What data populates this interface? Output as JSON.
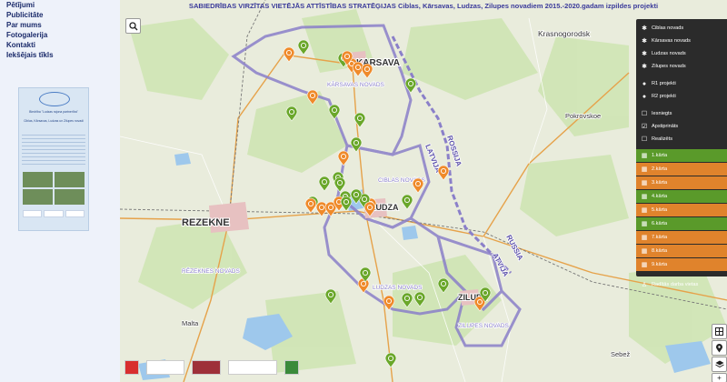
{
  "nav": {
    "items": [
      "Pētījumi",
      "Publicitāte",
      "Par mums",
      "Fotogalerija",
      "Kontakti",
      "Iekšējais tīkls"
    ]
  },
  "poster": {
    "org": "Biedrība \"Ludzas rajona partnerība\"",
    "lines": [
      "Biedrība \"Ludzas rajona partnerība\"",
      "Ciblas, Kārsavas, Ludzas un Zilupes novadi"
    ]
  },
  "map": {
    "title": "SABIEDRĪBAS VIRZĪTAS VIETĒJĀS ATTĪSTĪBAS STRATĒĢIJAS Ciblas, Kārsavas, Ludzas, Zilupes novadiem 2015.-2020.gadam izpildes projekti",
    "labels": {
      "rezekne": "REZEKNE",
      "karsava": "KARSAVA",
      "karsavas_novads": "KĀRSAVAS NOVADS",
      "ciblas_novads": "CIBLAS NOVADS",
      "ludza": "LUDZA",
      "ludzas_novads": "LUDZAS NOVADS",
      "zilupe": "ZILUPE",
      "zilupes_novads": "ZILUPES NOVADS",
      "rezeknes_novads": "RĒZEKNES NOVADS",
      "krasnogorodsk": "Krasnogorodsk",
      "latvija": "LATVIJA",
      "rossija1": "ROSSIJA",
      "rossija2": "RUSSIA",
      "atvija": "ATVIJA",
      "malta": "Malta",
      "sebez": "Sebež",
      "pokrovskoe": "Pokrovskoe"
    },
    "colors": {
      "green_pin": "#6aa72a",
      "orange_pin": "#ef8a2a",
      "border": "#8a7fc9"
    },
    "pins": [
      {
        "type": "green"
      },
      {
        "type": "orange"
      },
      {
        "type": "green"
      },
      {
        "type": "orange"
      },
      {
        "type": "orange"
      },
      {
        "type": "orange"
      },
      {
        "type": "orange"
      },
      {
        "type": "green"
      },
      {
        "type": "orange"
      },
      {
        "type": "green"
      },
      {
        "type": "green"
      },
      {
        "type": "green"
      },
      {
        "type": "green"
      },
      {
        "type": "orange"
      },
      {
        "type": "green"
      },
      {
        "type": "green"
      },
      {
        "type": "green"
      },
      {
        "type": "green"
      },
      {
        "type": "orange"
      },
      {
        "type": "green"
      },
      {
        "type": "orange"
      },
      {
        "type": "orange"
      },
      {
        "type": "orange"
      },
      {
        "type": "green"
      },
      {
        "type": "green"
      },
      {
        "type": "orange"
      },
      {
        "type": "green"
      },
      {
        "type": "orange"
      },
      {
        "type": "orange"
      },
      {
        "type": "orange"
      },
      {
        "type": "green"
      },
      {
        "type": "orange"
      },
      {
        "type": "green"
      },
      {
        "type": "green"
      },
      {
        "type": "green"
      },
      {
        "type": "orange"
      },
      {
        "type": "green"
      },
      {
        "type": "green"
      },
      {
        "type": "green"
      },
      {
        "type": "orange"
      },
      {
        "type": "green"
      }
    ]
  },
  "panel": {
    "novadi": [
      "Ciblas novads",
      "Kārsavas novads",
      "Ludzas novads",
      "Zilupes novads"
    ],
    "projekti": [
      "R1 projekti",
      "R2 projekti"
    ],
    "statusi": [
      "Iesniegts",
      "Apstiprināts",
      "Realizēts"
    ],
    "kartas": [
      {
        "label": "1.kārta",
        "color": "green"
      },
      {
        "label": "2.kārta",
        "color": "orange"
      },
      {
        "label": "3.kārta",
        "color": "orange"
      },
      {
        "label": "4.kārta",
        "color": "green"
      },
      {
        "label": "5.kārta",
        "color": "orange"
      },
      {
        "label": "6.kārta",
        "color": "green"
      },
      {
        "label": "7.kārta",
        "color": "orange"
      },
      {
        "label": "8.kārta",
        "color": "orange"
      },
      {
        "label": "9.kārta",
        "color": "orange"
      }
    ],
    "legend": "Radītās darba vietas"
  },
  "controls": {
    "search_icon": "search-icon",
    "grid_icon": "grid-icon",
    "layers_icon": "layers-icon",
    "locate_icon": "locate-icon",
    "zoom_in": "+",
    "zoom_out": "−"
  }
}
